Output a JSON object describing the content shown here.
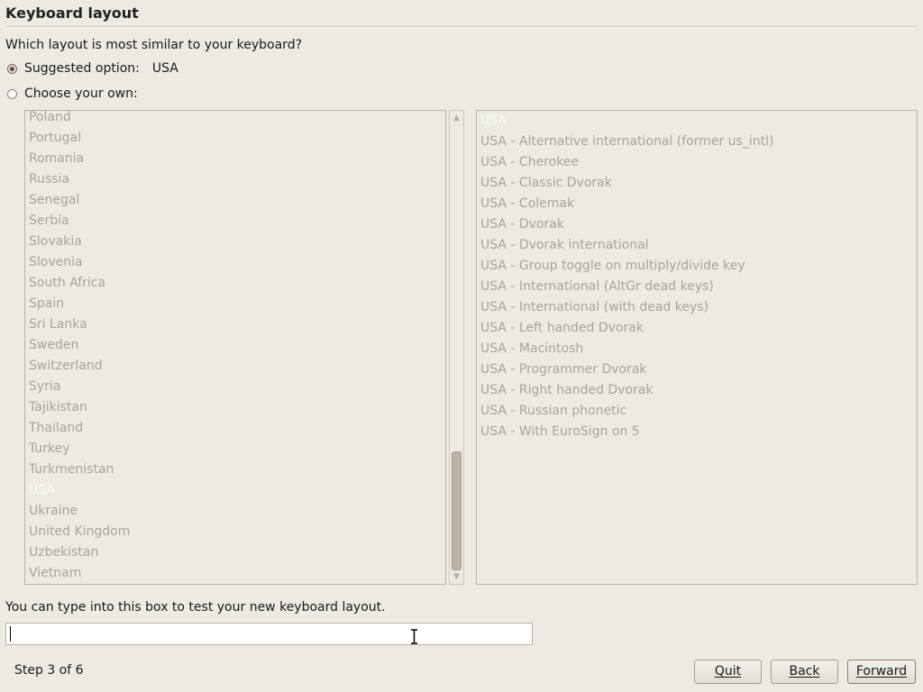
{
  "page": {
    "title": "Keyboard layout",
    "question": "Which layout is most similar to your keyboard?"
  },
  "options": {
    "suggested_label": "Suggested option:",
    "suggested_value": "USA",
    "choose_label": "Choose your own:"
  },
  "countries": [
    "Poland",
    "Portugal",
    "Romania",
    "Russia",
    "Senegal",
    "Serbia",
    "Slovakia",
    "Slovenia",
    "South Africa",
    "Spain",
    "Sri Lanka",
    "Sweden",
    "Switzerland",
    "Syria",
    "Tajikistan",
    "Thailand",
    "Turkey",
    "Turkmenistan",
    "USA",
    "Ukraine",
    "United Kingdom",
    "Uzbekistan",
    "Vietnam"
  ],
  "selected_country": "USA",
  "variants": [
    "USA",
    "USA - Alternative international (former us_intl)",
    "USA - Cherokee",
    "USA - Classic Dvorak",
    "USA - Colemak",
    "USA - Dvorak",
    "USA - Dvorak international",
    "USA - Group toggle on multiply/divide key",
    "USA - International (AltGr dead keys)",
    "USA - International (with dead keys)",
    "USA - Left handed Dvorak",
    "USA - Macintosh",
    "USA - Programmer Dvorak",
    "USA - Right handed Dvorak",
    "USA - Russian phonetic",
    "USA - With EuroSign on 5"
  ],
  "selected_variant": "USA",
  "test": {
    "label": "You can type into this box to test your new keyboard layout.",
    "value": ""
  },
  "footer": {
    "step": "Step 3 of 6",
    "quit": "Quit",
    "back": "Back",
    "forward": "Forward"
  }
}
